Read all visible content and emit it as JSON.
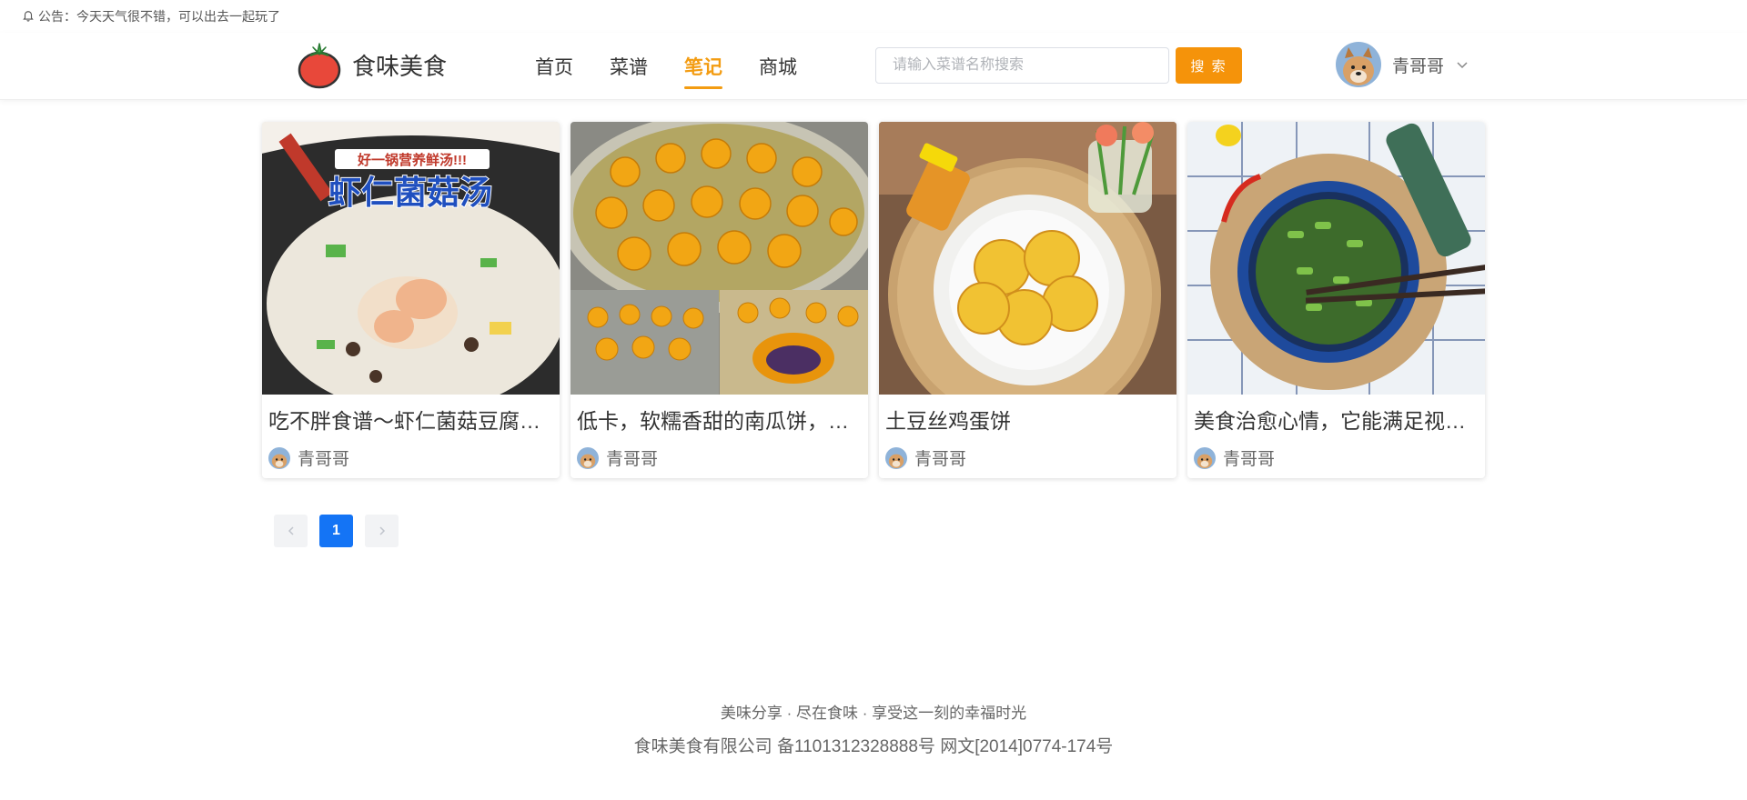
{
  "notice": {
    "icon": "bell-icon",
    "text": "公告：今天天气很不错，可以出去一起玩了"
  },
  "header": {
    "logo_icon": "tomato-logo-icon",
    "logo_text": "食味美食",
    "nav": [
      {
        "label": "首页",
        "active": false
      },
      {
        "label": "菜谱",
        "active": false
      },
      {
        "label": "笔记",
        "active": true
      },
      {
        "label": "商城",
        "active": false
      }
    ],
    "search": {
      "placeholder": "请输入菜谱名称搜索",
      "value": "",
      "button_label": "搜 索"
    },
    "user": {
      "name": "青哥哥",
      "dropdown_icon": "chevron-down-icon"
    }
  },
  "notes": [
    {
      "title": "吃不胖食谱～虾仁菌菇豆腐汤｜鲜美暖胃",
      "author": "青哥哥",
      "image_banner": "好一锅营养鲜汤!!!",
      "image_caption": "虾仁菌菇汤"
    },
    {
      "title": "低卡，软糯香甜的南瓜饼，值得一试",
      "author": "青哥哥"
    },
    {
      "title": "土豆丝鸡蛋饼",
      "author": "青哥哥"
    },
    {
      "title": "美食治愈心情，它能满足视觉和味觉",
      "author": "青哥哥"
    }
  ],
  "pagination": {
    "prev_icon": "chevron-left-icon",
    "current_page": "1",
    "next_icon": "chevron-right-icon"
  },
  "footer": {
    "slogan": "美味分享 · 尽在食味 · 享受这一刻的幸福时光",
    "icp": "食味美食有限公司 备1101312328888号 网文[2014]0774-174号"
  },
  "colors": {
    "accent": "#f5930a",
    "primary": "#1474f5"
  }
}
